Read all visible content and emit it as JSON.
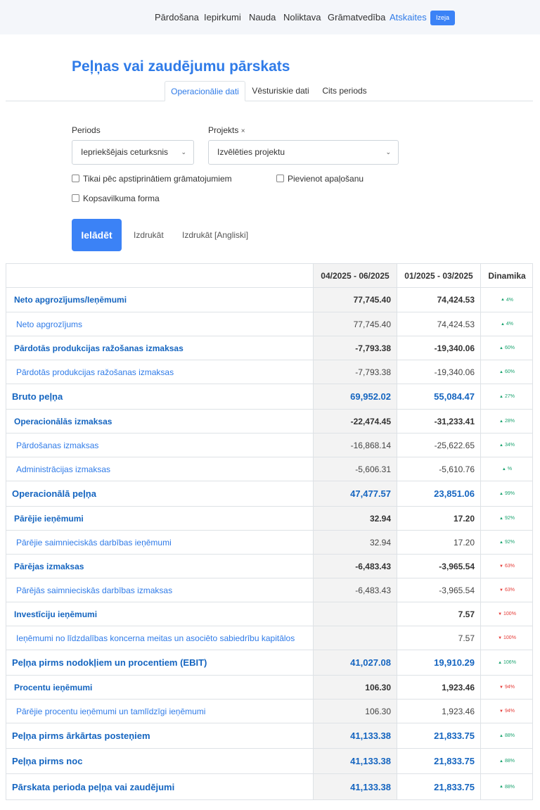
{
  "nav": {
    "items": [
      {
        "label": "Pārdošana",
        "active": false
      },
      {
        "label": "Iepirkumi",
        "active": false
      },
      {
        "label": "Nauda",
        "active": false
      },
      {
        "label": "Noliktava",
        "active": false
      },
      {
        "label": "Grāmatvedība",
        "active": false
      },
      {
        "label": "Atskaites",
        "active": true
      }
    ],
    "exit_label": "Izeja"
  },
  "page": {
    "title": "Peļņas vai zaudējumu pārskats"
  },
  "tabs": [
    {
      "label": "Operacionālie dati",
      "active": true
    },
    {
      "label": "Vēsturiskie dati",
      "active": false
    },
    {
      "label": "Cits periods",
      "active": false
    }
  ],
  "filters": {
    "period_label": "Periods",
    "period_value": "Iepriekšējais ceturksnis",
    "project_label": "Projekts",
    "project_clear": "×",
    "project_value": "Izvēlēties projektu",
    "checkboxes": [
      {
        "label": "Tikai pēc apstiprinātiem grāmatojumiem",
        "checked": false
      },
      {
        "label": "Pievienot apaļošanu",
        "checked": false
      },
      {
        "label": "Kopsavilkuma forma",
        "checked": false
      }
    ]
  },
  "actions": {
    "load_label": "Ielādēt",
    "print_label": "Izdrukāt",
    "print_en_label": "Izdrukāt [Angliski]"
  },
  "report": {
    "headers": [
      "",
      "04/2025 - 06/2025",
      "01/2025 - 03/2025",
      "Dinamika"
    ],
    "rows": [
      {
        "label": "Neto apgrozījums/Ieņēmumi",
        "v1": "77,745.40",
        "v2": "74,424.53",
        "dyn": "4%",
        "dir": "up",
        "level": "section"
      },
      {
        "label": "Neto apgrozījums",
        "v1": "77,745.40",
        "v2": "74,424.53",
        "dyn": "4%",
        "dir": "up",
        "level": "item"
      },
      {
        "label": "Pārdotās produkcijas ražošanas izmaksas",
        "v1": "-7,793.38",
        "v2": "-19,340.06",
        "dyn": "60%",
        "dir": "up",
        "level": "section"
      },
      {
        "label": "Pārdotās produkcijas ražošanas izmaksas",
        "v1": "-7,793.38",
        "v2": "-19,340.06",
        "dyn": "60%",
        "dir": "up",
        "level": "item"
      },
      {
        "label": "Bruto peļņa",
        "v1": "69,952.02",
        "v2": "55,084.47",
        "dyn": "27%",
        "dir": "up",
        "level": "total"
      },
      {
        "label": "Operacionālās izmaksas",
        "v1": "-22,474.45",
        "v2": "-31,233.41",
        "dyn": "28%",
        "dir": "up",
        "level": "section"
      },
      {
        "label": "Pārdošanas izmaksas",
        "v1": "-16,868.14",
        "v2": "-25,622.65",
        "dyn": "34%",
        "dir": "up",
        "level": "item"
      },
      {
        "label": "Administrācijas izmaksas",
        "v1": "-5,606.31",
        "v2": "-5,610.76",
        "dyn": "%",
        "dir": "up",
        "level": "item"
      },
      {
        "label": "Operacionālā peļņa",
        "v1": "47,477.57",
        "v2": "23,851.06",
        "dyn": "99%",
        "dir": "up",
        "level": "total"
      },
      {
        "label": "Pārējie ieņēmumi",
        "v1": "32.94",
        "v2": "17.20",
        "dyn": "92%",
        "dir": "up",
        "level": "section"
      },
      {
        "label": "Pārējie saimnieciskās darbības ieņēmumi",
        "v1": "32.94",
        "v2": "17.20",
        "dyn": "92%",
        "dir": "up",
        "level": "item"
      },
      {
        "label": "Pārējas izmaksas",
        "v1": "-6,483.43",
        "v2": "-3,965.54",
        "dyn": "63%",
        "dir": "down",
        "level": "section"
      },
      {
        "label": "Pārējās saimnieciskās darbības izmaksas",
        "v1": "-6,483.43",
        "v2": "-3,965.54",
        "dyn": "63%",
        "dir": "down",
        "level": "item"
      },
      {
        "label": "Investīciju ieņēmumi",
        "v1": "",
        "v2": "7.57",
        "dyn": "100%",
        "dir": "down",
        "level": "section"
      },
      {
        "label": "Ieņēmumi no līdzdalības koncerna meitas un asociēto sabiedrību kapitālos",
        "v1": "",
        "v2": "7.57",
        "dyn": "100%",
        "dir": "down",
        "level": "item"
      },
      {
        "label": "Peļņa pirms nodokļiem un procentiem (EBIT)",
        "v1": "41,027.08",
        "v2": "19,910.29",
        "dyn": "106%",
        "dir": "up",
        "level": "total"
      },
      {
        "label": "Procentu ieņēmumi",
        "v1": "106.30",
        "v2": "1,923.46",
        "dyn": "94%",
        "dir": "down",
        "level": "section"
      },
      {
        "label": "Pārējie procentu ieņēmumi un tamlīdzīgi ieņēmumi",
        "v1": "106.30",
        "v2": "1,923.46",
        "dyn": "94%",
        "dir": "down",
        "level": "item"
      },
      {
        "label": "Peļņa pirms ārkārtas posteņiem",
        "v1": "41,133.38",
        "v2": "21,833.75",
        "dyn": "88%",
        "dir": "up",
        "level": "total"
      },
      {
        "label": "Peļņa pirms noc",
        "v1": "41,133.38",
        "v2": "21,833.75",
        "dyn": "88%",
        "dir": "up",
        "level": "total"
      },
      {
        "label": "Pārskata perioda peļņa vai zaudējumi",
        "v1": "41,133.38",
        "v2": "21,833.75",
        "dyn": "88%",
        "dir": "up",
        "level": "total"
      }
    ]
  }
}
